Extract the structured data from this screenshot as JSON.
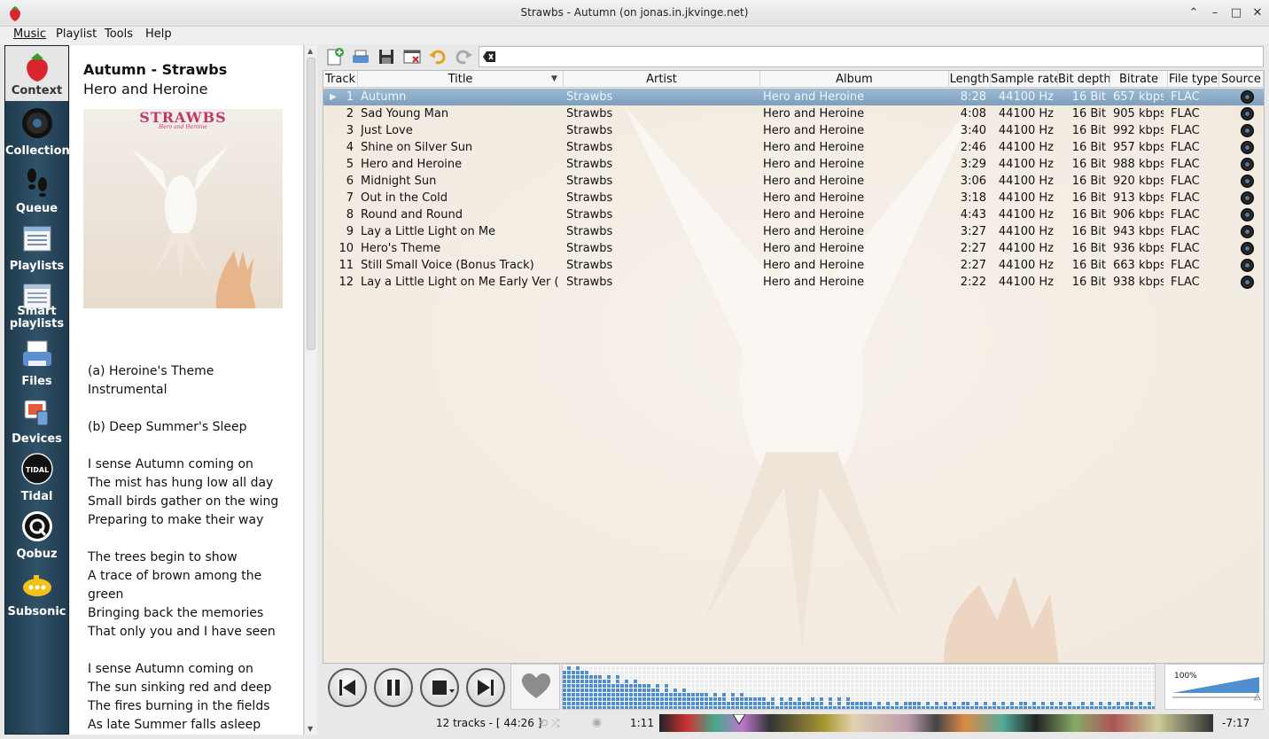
{
  "window": {
    "title": "Strawbs - Autumn (on jonas.in.jkvinge.net)"
  },
  "menu": [
    "Music",
    "Playlist",
    "Tools",
    "Help"
  ],
  "sidebar": [
    {
      "label": "Context",
      "icon": "strawberry-icon"
    },
    {
      "label": "Collection",
      "icon": "vinyl-disc-icon"
    },
    {
      "label": "Queue",
      "icon": "footprints-icon"
    },
    {
      "label": "Playlists",
      "icon": "playlist-icon"
    },
    {
      "label": "Smart\nplaylists",
      "icon": "smart-playlist-icon"
    },
    {
      "label": "Files",
      "icon": "printer-files-icon"
    },
    {
      "label": "Devices",
      "icon": "devices-icon"
    },
    {
      "label": "Tidal",
      "icon": "tidal-icon"
    },
    {
      "label": "Qobuz",
      "icon": "qobuz-icon"
    },
    {
      "label": "Subsonic",
      "icon": "subsonic-icon"
    }
  ],
  "context": {
    "title": "Autumn - Strawbs",
    "album": "Hero and Heroine",
    "cover_text": "STRAWBS",
    "cover_sub": "Hero and Heroine",
    "lyrics": "(a) Heroine's Theme\nInstrumental\n\n(b) Deep Summer's Sleep\n\nI sense Autumn coming on\nThe mist has hung low all day\nSmall birds gather on the wing\nPreparing to make their way\n\nThe trees begin to show\nA trace of brown among the green\nBringing back the memories\nThat only you and I have seen\n\nI sense Autumn coming on\nThe sun sinking red and deep\nThe fires burning in the fields\nAs late Summer falls asleep"
  },
  "playlist": {
    "columns": [
      "Track",
      "Title",
      "Artist",
      "Album",
      "Length",
      "Sample rate",
      "Bit depth",
      "Bitrate",
      "File type",
      "Source"
    ],
    "rows": [
      {
        "track": "1",
        "title": "Autumn",
        "artist": "Strawbs",
        "album": "Hero and Heroine",
        "length": "8:28",
        "rate": "44100 Hz",
        "depth": "16 Bit",
        "bitrate": "657 kbps",
        "type": "FLAC",
        "current": true
      },
      {
        "track": "2",
        "title": "Sad Young Man",
        "artist": "Strawbs",
        "album": "Hero and Heroine",
        "length": "4:08",
        "rate": "44100 Hz",
        "depth": "16 Bit",
        "bitrate": "905 kbps",
        "type": "FLAC"
      },
      {
        "track": "3",
        "title": "Just Love",
        "artist": "Strawbs",
        "album": "Hero and Heroine",
        "length": "3:40",
        "rate": "44100 Hz",
        "depth": "16 Bit",
        "bitrate": "992 kbps",
        "type": "FLAC"
      },
      {
        "track": "4",
        "title": "Shine on Silver Sun",
        "artist": "Strawbs",
        "album": "Hero and Heroine",
        "length": "2:46",
        "rate": "44100 Hz",
        "depth": "16 Bit",
        "bitrate": "957 kbps",
        "type": "FLAC"
      },
      {
        "track": "5",
        "title": "Hero and Heroine",
        "artist": "Strawbs",
        "album": "Hero and Heroine",
        "length": "3:29",
        "rate": "44100 Hz",
        "depth": "16 Bit",
        "bitrate": "988 kbps",
        "type": "FLAC"
      },
      {
        "track": "6",
        "title": "Midnight Sun",
        "artist": "Strawbs",
        "album": "Hero and Heroine",
        "length": "3:06",
        "rate": "44100 Hz",
        "depth": "16 Bit",
        "bitrate": "920 kbps",
        "type": "FLAC"
      },
      {
        "track": "7",
        "title": "Out in the Cold",
        "artist": "Strawbs",
        "album": "Hero and Heroine",
        "length": "3:18",
        "rate": "44100 Hz",
        "depth": "16 Bit",
        "bitrate": "913 kbps",
        "type": "FLAC"
      },
      {
        "track": "8",
        "title": "Round and Round",
        "artist": "Strawbs",
        "album": "Hero and Heroine",
        "length": "4:43",
        "rate": "44100 Hz",
        "depth": "16 Bit",
        "bitrate": "906 kbps",
        "type": "FLAC"
      },
      {
        "track": "9",
        "title": "Lay a Little Light on Me",
        "artist": "Strawbs",
        "album": "Hero and Heroine",
        "length": "3:27",
        "rate": "44100 Hz",
        "depth": "16 Bit",
        "bitrate": "943 kbps",
        "type": "FLAC"
      },
      {
        "track": "10",
        "title": "Hero's Theme",
        "artist": "Strawbs",
        "album": "Hero and Heroine",
        "length": "2:27",
        "rate": "44100 Hz",
        "depth": "16 Bit",
        "bitrate": "936 kbps",
        "type": "FLAC"
      },
      {
        "track": "11",
        "title": "Still Small Voice (Bonus Track)",
        "artist": "Strawbs",
        "album": "Hero and Heroine",
        "length": "2:27",
        "rate": "44100 Hz",
        "depth": "16 Bit",
        "bitrate": "663 kbps",
        "type": "FLAC"
      },
      {
        "track": "12",
        "title": "Lay a Little Light on Me Early Ver (B…",
        "artist": "Strawbs",
        "album": "Hero and Heroine",
        "length": "2:22",
        "rate": "44100 Hz",
        "depth": "16 Bit",
        "bitrate": "938 kbps",
        "type": "FLAC"
      }
    ]
  },
  "controls": {
    "volume": "100%",
    "volume_level": 1.0,
    "playback_position": 0.144
  },
  "status": {
    "summary": "12 tracks - [ 44:26 ]",
    "elapsed": "1:11",
    "remaining": "-7:17"
  },
  "colors": {
    "sidebar": "#2f5268",
    "current_row": "#8fb0cc",
    "analyzer": "#4f8fcf"
  }
}
